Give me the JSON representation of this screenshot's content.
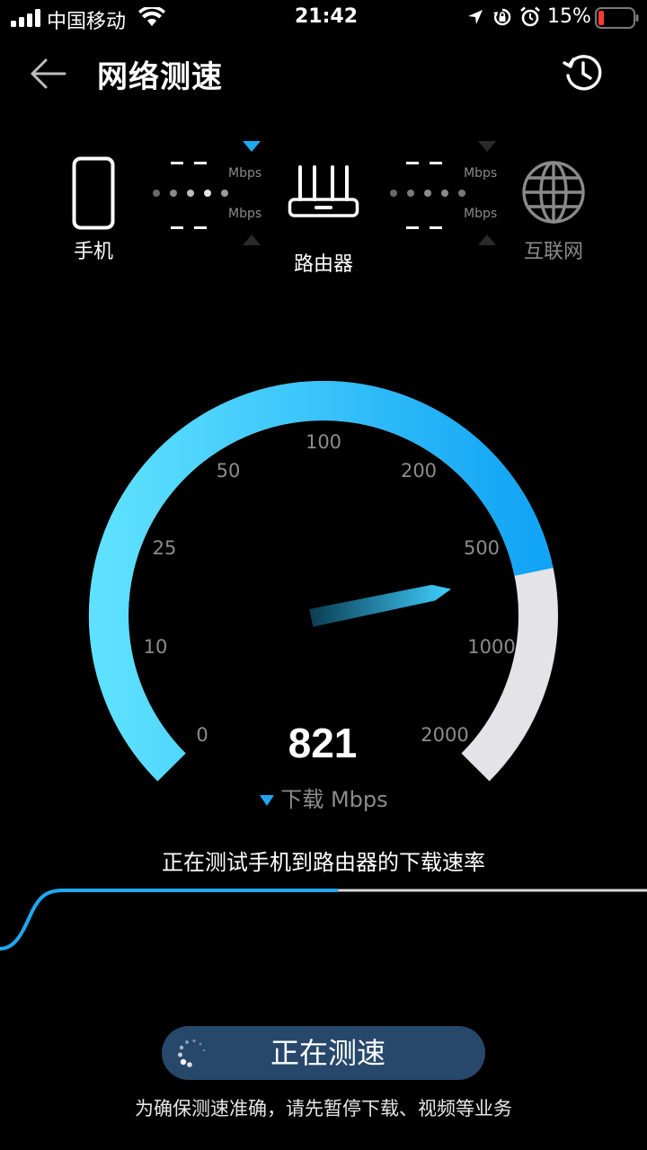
{
  "status_bar": {
    "carrier": "中国移动",
    "time": "21:42",
    "battery": "15%"
  },
  "header": {
    "title": "网络测速",
    "back_icon": "back-arrow-icon",
    "history_icon": "history-clock-icon"
  },
  "topology": {
    "phone_label": "手机",
    "router_label": "路由器",
    "internet_label": "互联网",
    "left_link": {
      "upload_value": "- -",
      "download_value": "- -",
      "unit": "Mbps"
    },
    "right_link": {
      "upload_value": "- -",
      "download_value": "- -",
      "unit": "Mbps"
    }
  },
  "gauge": {
    "ticks": [
      "0",
      "10",
      "25",
      "50",
      "100",
      "200",
      "500",
      "1000",
      "2000"
    ],
    "value": "821",
    "direction_label": "下载 Mbps",
    "fill_fraction": 0.79
  },
  "status_text": "正在测试手机到路由器的下载速率",
  "progress": 0.52,
  "test_button_label": "正在测速",
  "footer_tip": "为确保测速准确，请先暂停下载、视频等业务",
  "colors": {
    "accent": "#1fa8f2",
    "accent_light": "#5ee1ff",
    "track": "#e4e4e8",
    "button_bg": "#27486b"
  }
}
